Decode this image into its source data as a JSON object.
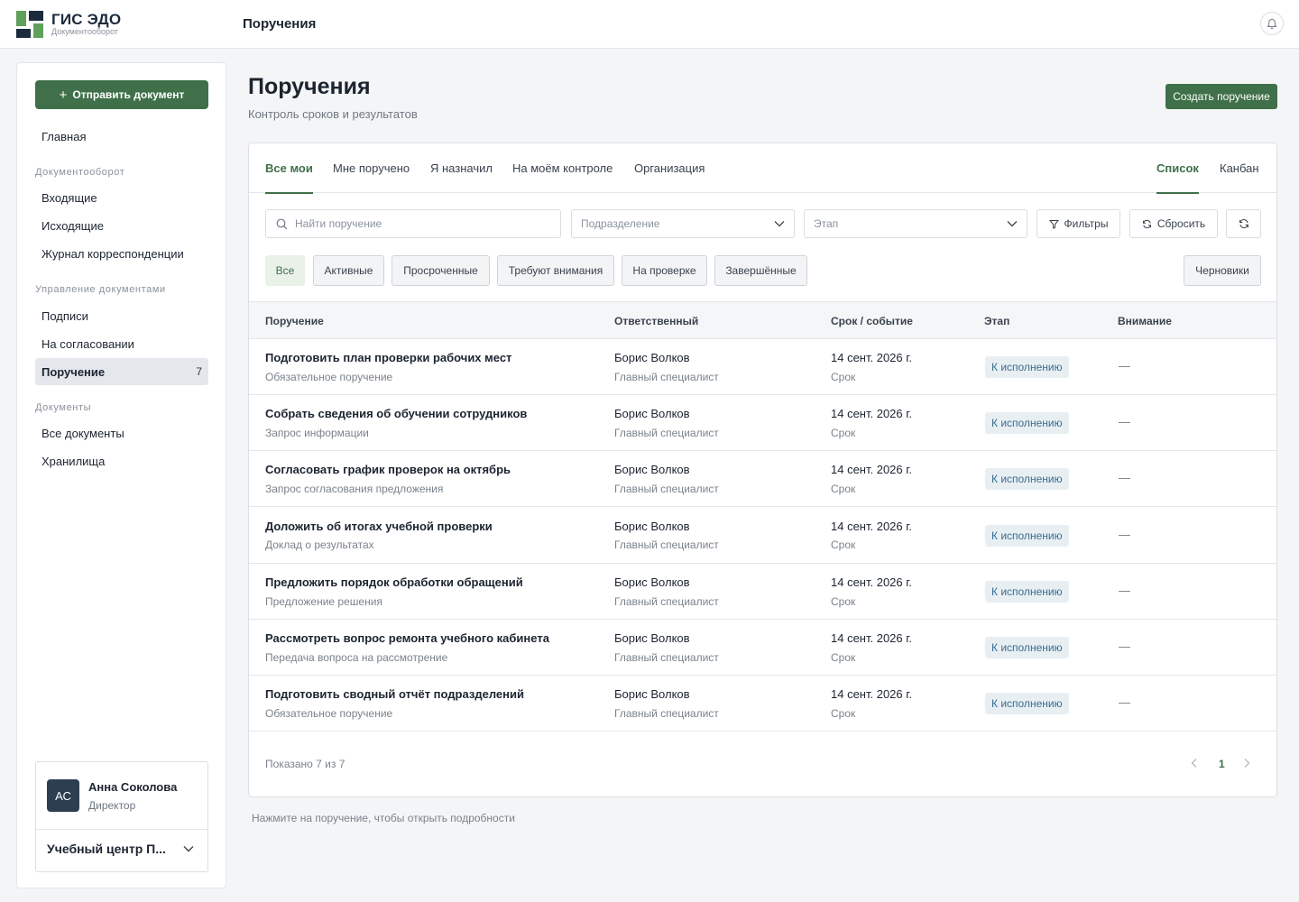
{
  "brand": {
    "title": "ГИС ЭДО",
    "subtitle": "Документооборот",
    "colors": {
      "dark": "#1c2a3d",
      "green": "#5fa05a"
    }
  },
  "header": {
    "title": "Поручения",
    "notifications_icon": "bell-icon"
  },
  "sidebar": {
    "send_button": "Отправить документ",
    "home": "Главная",
    "sections": [
      {
        "title": "Документооборот",
        "items": [
          {
            "label": "Входящие"
          },
          {
            "label": "Исходящие"
          },
          {
            "label": "Журнал корреспонденции"
          }
        ]
      },
      {
        "title": "Управление документами",
        "items": [
          {
            "label": "Подписи"
          },
          {
            "label": "На согласовании"
          },
          {
            "label": "Поручение",
            "count": "7",
            "active": true
          }
        ]
      },
      {
        "title": "Документы",
        "items": [
          {
            "label": "Все документы"
          },
          {
            "label": "Хранилища"
          }
        ]
      }
    ],
    "user": {
      "initials": "АС",
      "name": "Анна Соколова",
      "role": "Директор",
      "org": "Учебный центр П..."
    }
  },
  "page": {
    "title": "Поручения",
    "subtitle": "Контроль сроков и результатов",
    "create_button": "Создать поручение"
  },
  "tabs": [
    {
      "label": "Все мои",
      "active": true
    },
    {
      "label": "Мне поручено"
    },
    {
      "label": "Я назначил"
    },
    {
      "label": "На моём контроле"
    },
    {
      "label": "Организация"
    }
  ],
  "view_tabs": [
    {
      "label": "Список",
      "active": true
    },
    {
      "label": "Канбан"
    }
  ],
  "filters": {
    "search_placeholder": "Найти поручение",
    "department_placeholder": "Подразделение",
    "stage_placeholder": "Этап",
    "filters_button": "Фильтры",
    "reset_button": "Сбросить"
  },
  "chips": [
    {
      "label": "Все",
      "active": true
    },
    {
      "label": "Активные"
    },
    {
      "label": "Просроченные"
    },
    {
      "label": "Требуют внимания"
    },
    {
      "label": "На проверке"
    },
    {
      "label": "Завершённые"
    }
  ],
  "drafts_button": "Черновики",
  "table": {
    "columns": [
      "Поручение",
      "Ответственный",
      "Срок / событие",
      "Этап",
      "Внимание"
    ],
    "rows": [
      {
        "title": "Подготовить план проверки рабочих мест",
        "type": "Обязательное поручение",
        "person": "Борис Волков",
        "position": "Главный специалист",
        "date": "14 сент. 2026 г.",
        "event": "Срок",
        "stage": "К исполнению",
        "attention": "—"
      },
      {
        "title": "Собрать сведения об обучении сотрудников",
        "type": "Запрос информации",
        "person": "Борис Волков",
        "position": "Главный специалист",
        "date": "14 сент. 2026 г.",
        "event": "Срок",
        "stage": "К исполнению",
        "attention": "—"
      },
      {
        "title": "Согласовать график проверок на октябрь",
        "type": "Запрос согласования предложения",
        "person": "Борис Волков",
        "position": "Главный специалист",
        "date": "14 сент. 2026 г.",
        "event": "Срок",
        "stage": "К исполнению",
        "attention": "—"
      },
      {
        "title": "Доложить об итогах учебной проверки",
        "type": "Доклад о результатах",
        "person": "Борис Волков",
        "position": "Главный специалист",
        "date": "14 сент. 2026 г.",
        "event": "Срок",
        "stage": "К исполнению",
        "attention": "—"
      },
      {
        "title": "Предложить порядок обработки обращений",
        "type": "Предложение решения",
        "person": "Борис Волков",
        "position": "Главный специалист",
        "date": "14 сент. 2026 г.",
        "event": "Срок",
        "stage": "К исполнению",
        "attention": "—"
      },
      {
        "title": "Рассмотреть вопрос ремонта учебного кабинета",
        "type": "Передача вопроса на рассмотрение",
        "person": "Борис Волков",
        "position": "Главный специалист",
        "date": "14 сент. 2026 г.",
        "event": "Срок",
        "stage": "К исполнению",
        "attention": "—"
      },
      {
        "title": "Подготовить сводный отчёт подразделений",
        "type": "Обязательное поручение",
        "person": "Борис Волков",
        "position": "Главный специалист",
        "date": "14 сент. 2026 г.",
        "event": "Срок",
        "stage": "К исполнению",
        "attention": "—"
      }
    ]
  },
  "footer": {
    "shown": "Показано 7 из 7",
    "page": "1"
  },
  "hint": "Нажмите на поручение, чтобы открыть подробности"
}
